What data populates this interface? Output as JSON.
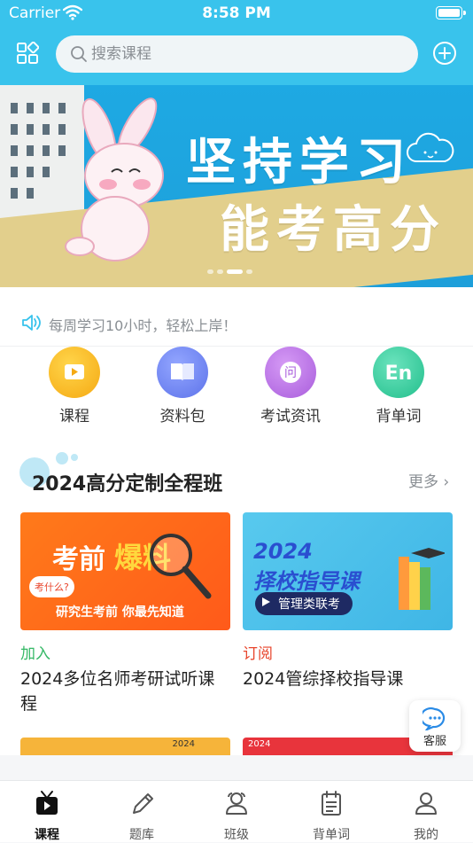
{
  "status_bar": {
    "carrier": "Carrier",
    "time": "8:58 PM"
  },
  "header": {
    "search_placeholder": "搜索课程"
  },
  "banner": {
    "line1": "坚持学习",
    "line2": "能考高分",
    "page_count": 4,
    "active_page": 3
  },
  "notice": {
    "text": "每周学习10小时，轻松上岸！"
  },
  "quick_links": [
    {
      "label": "课程",
      "icon": "video-icon",
      "color": "#f5b21b"
    },
    {
      "label": "资料包",
      "icon": "book-icon",
      "color": "#6d83f2"
    },
    {
      "label": "考试资讯",
      "icon": "question-icon",
      "color": "#b56ae0"
    },
    {
      "label": "背单词",
      "icon": "english-icon",
      "color": "#2fcb9c"
    }
  ],
  "section": {
    "title": "2024高分定制全程班",
    "more": "更多",
    "cards": [
      {
        "tag": "加入",
        "tag_color": "#35b866",
        "name": "2024多位名师考研试听课程",
        "thumb": {
          "headline_a": "考前",
          "headline_b": "爆料",
          "badge": "考什么?",
          "subline": "研究生考前 你最先知道"
        }
      },
      {
        "tag": "订阅",
        "tag_color": "#e8452c",
        "name": "2024管综择校指导课",
        "thumb": {
          "headline_a": "2024",
          "headline_b": "择校指导课",
          "pill": "管理类联考"
        }
      }
    ],
    "partial_cards": [
      {
        "label": "2024"
      },
      {
        "label": "2024"
      }
    ]
  },
  "floating": {
    "service": "客服"
  },
  "tabs": [
    {
      "label": "课程",
      "icon": "tv-icon",
      "active": true
    },
    {
      "label": "题库",
      "icon": "pencil-icon",
      "active": false
    },
    {
      "label": "班级",
      "icon": "group-icon",
      "active": false
    },
    {
      "label": "背单词",
      "icon": "calendar-icon",
      "active": false
    },
    {
      "label": "我的",
      "icon": "user-icon",
      "active": false
    }
  ],
  "colors": {
    "primary": "#39c3ec",
    "banner": "#1ea9e3"
  }
}
